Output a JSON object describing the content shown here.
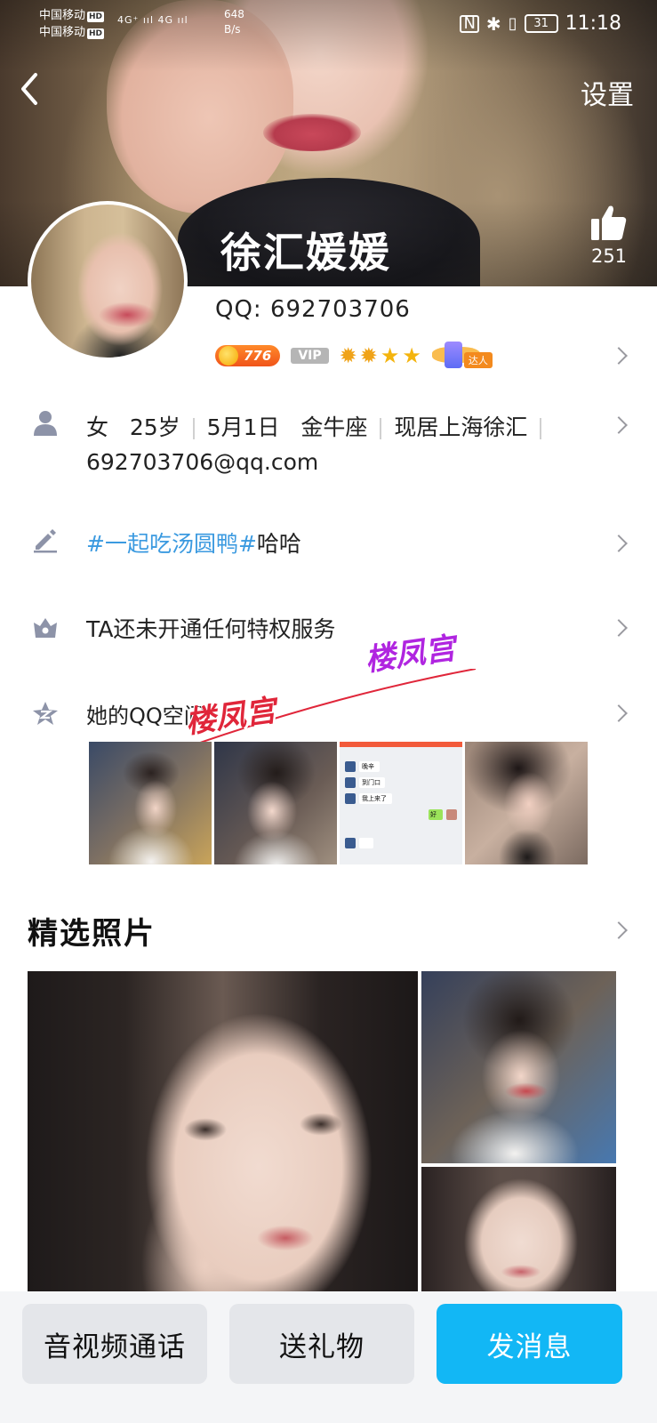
{
  "status_bar": {
    "carrier1": "中国移动",
    "carrier2": "中国移动",
    "hd": "HD",
    "signal": "4G⁺ ııl 4G ııl",
    "net_speed_value": "648",
    "net_speed_unit": "B/s",
    "battery": "31",
    "time": "11:18"
  },
  "header": {
    "settings_label": "设置",
    "name": "徐汇媛媛",
    "like_count": "251"
  },
  "profile": {
    "qq_label": "QQ:",
    "qq_number": "692703706",
    "coin_level": "776",
    "vip_label": "VIP",
    "talent_label": "达人"
  },
  "info": {
    "gender": "女",
    "age": "25岁",
    "birthday": "5月1日",
    "zodiac": "金牛座",
    "location": "现居上海徐汇",
    "email": "692703706@qq.com"
  },
  "signature": {
    "tag": "#一起吃汤圆鸭#",
    "text": "哈哈"
  },
  "privilege": {
    "text": "TA还未开通任何特权服务"
  },
  "qzone": {
    "label": "她的QQ空间",
    "chat_lines": [
      "晚辛",
      "到门口",
      "我上来了",
      "好"
    ]
  },
  "watermark": {
    "text1": "楼凤宫",
    "text2": "楼凤宫"
  },
  "photos": {
    "title": "精选照片"
  },
  "actions": {
    "call": "音视频通话",
    "gift": "送礼物",
    "message": "发消息"
  },
  "colors": {
    "accent": "#12b7f5",
    "tag_blue": "#3b9ae0",
    "coin_orange": "#f0541a"
  }
}
